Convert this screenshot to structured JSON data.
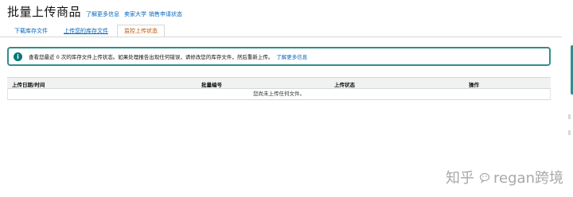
{
  "header": {
    "title": "批量上传商品",
    "links": [
      "了解更多信息",
      "卖家大学",
      "销售申请状态"
    ]
  },
  "tabs": [
    {
      "label": "下载库存文件"
    },
    {
      "label": "上传您的库存文件"
    },
    {
      "label": "监控上传状态"
    }
  ],
  "alert": {
    "icon": "info-icon",
    "icon_glyph": "i",
    "message": "查看您最近 0 次的库存文件上传状态。如果处理报告出现任何错误，请修改您的库存文件，然后重新上传。",
    "link": "了解更多信息"
  },
  "table": {
    "columns": [
      "上传日期/时间",
      "批量编号",
      "上传状态",
      "操作"
    ],
    "empty_message": "您尚未上传任何文件。"
  },
  "watermark": {
    "site": "知乎",
    "brand": "regan跨境"
  },
  "colors": {
    "link": "#0066c0",
    "active_tab": "#c45500",
    "alert_border": "#2f8f8a",
    "info_icon": "#00787a",
    "table_header_bg": "#f0f2f2"
  }
}
